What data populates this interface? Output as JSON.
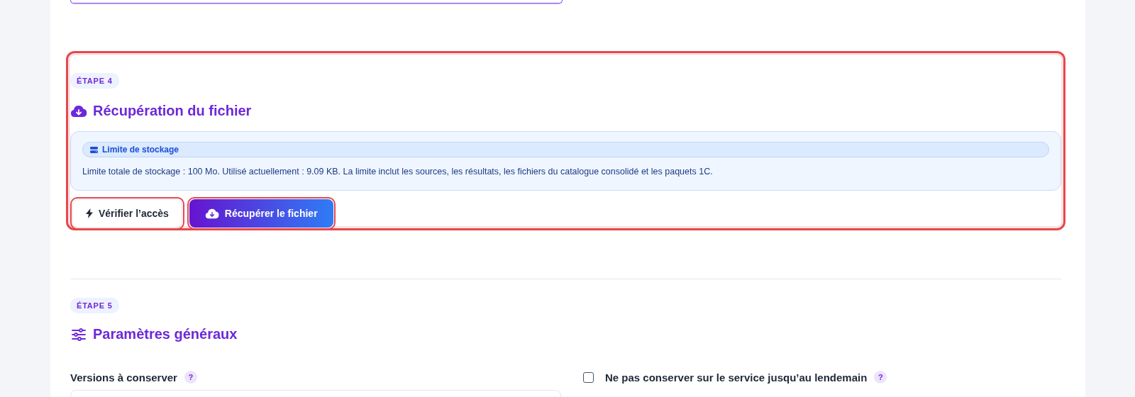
{
  "steps": [
    {
      "badge": "ÉTAPE 4",
      "title": "Récupération du fichier",
      "kind": "cloud-download",
      "highlighted": true,
      "notice": {
        "label": "Limite de stockage",
        "text": "Limite totale de stockage : 100 Mo. Utilisé actuellement : 9.09 KB. La limite inclut les sources, les résultats, les fichiers du catalogue consolidé et les paquets 1C."
      },
      "buttons": [
        {
          "label": "Vérifier l’accès",
          "kind": "secondary",
          "highlighted": true
        },
        {
          "label": "Récupérer le fichier",
          "kind": "primary",
          "highlighted": true
        }
      ]
    },
    {
      "badge": "ÉTAPE 5",
      "title": "Paramètres généraux",
      "kind": "sliders",
      "highlighted": false,
      "fields": [
        {
          "kind": "number",
          "label": "Versions à conserver",
          "help": "?"
        },
        {
          "kind": "checkbox",
          "label": "Ne pas conserver sur le service jusqu’au lendemain",
          "help": "?",
          "checked": false
        }
      ]
    }
  ]
}
